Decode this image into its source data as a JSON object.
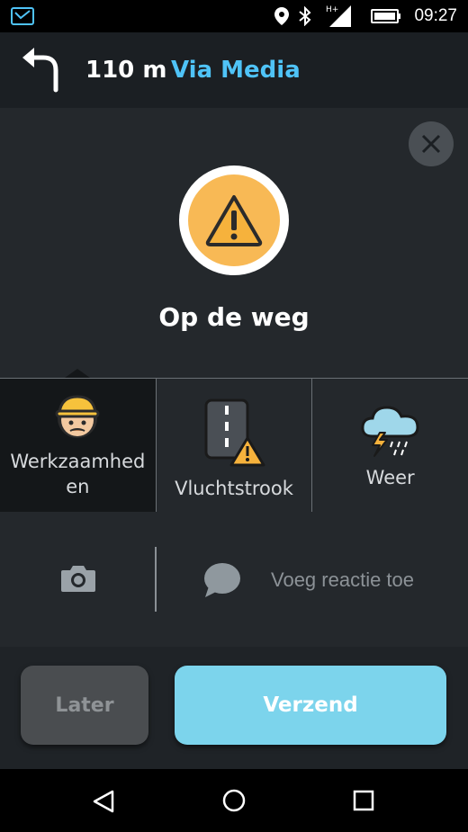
{
  "status_bar": {
    "time": "09:27",
    "icons": [
      "mail-icon",
      "location-icon",
      "bluetooth-icon",
      "signal-icon",
      "battery-icon"
    ]
  },
  "navigation": {
    "turn_icon": "turn-left-icon",
    "distance": "110 m",
    "street": "Via Media",
    "street_color": "#4fc3f7"
  },
  "report": {
    "icon": "hazard-warning-icon",
    "title": "Op de weg",
    "accent_color": "#f8b955"
  },
  "subcategories": [
    {
      "label": "Werkzaamhed\nen",
      "icon": "construction-worker-icon",
      "selected": true
    },
    {
      "label": "Vluchtstrook",
      "icon": "road-shoulder-warning-icon",
      "selected": false
    },
    {
      "label": "Weer",
      "icon": "thunderstorm-icon",
      "selected": false
    }
  ],
  "comment": {
    "camera_icon": "camera-icon",
    "comment_icon": "speech-bubble-icon",
    "placeholder": "Voeg reactie toe"
  },
  "buttons": {
    "later": "Later",
    "send": "Verzend",
    "send_color": "#7cd4ec"
  },
  "system_nav": [
    "back-icon",
    "home-icon",
    "recents-icon"
  ]
}
